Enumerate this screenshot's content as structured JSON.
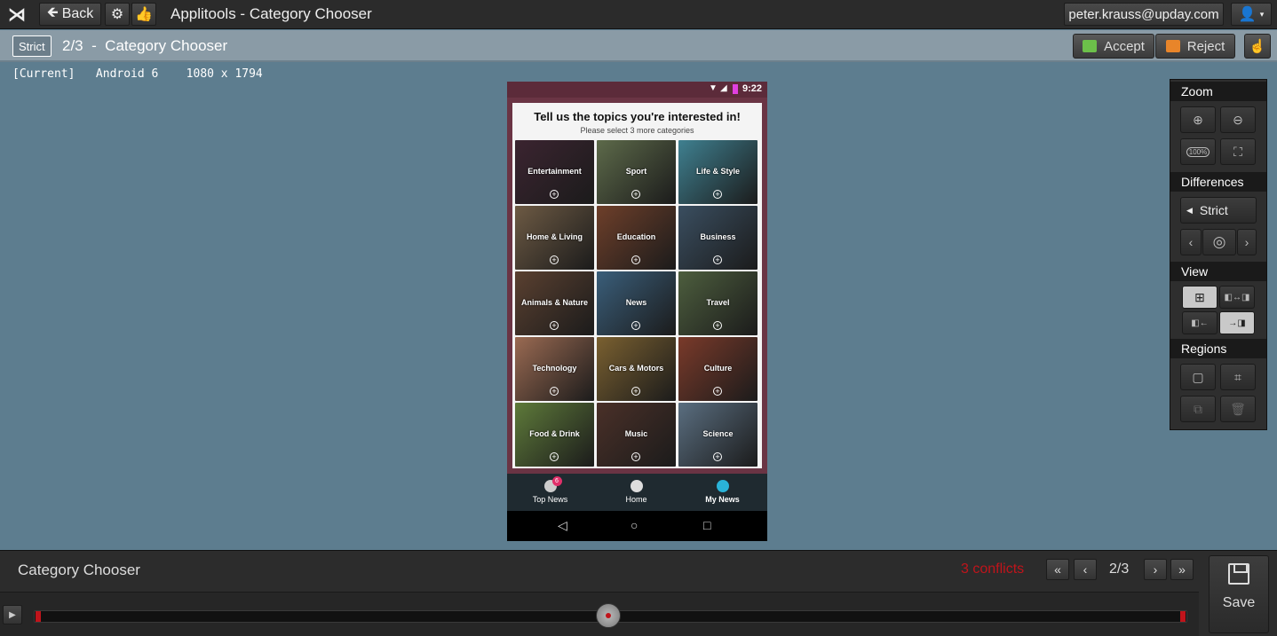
{
  "topbar": {
    "back_label": "Back",
    "title": "Applitools - Category Chooser",
    "user_email": "peter.krauss@upday.com"
  },
  "subbar": {
    "mode_badge": "Strict",
    "step_title": "2/3  -  Category Chooser",
    "accept_label": "Accept",
    "reject_label": "Reject"
  },
  "meta": {
    "line": "[Current]   Android 6    1080 x 1794"
  },
  "phone": {
    "time": "9:22",
    "card_title": "Tell us the topics you're interested in!",
    "card_subtitle": "Please select 3 more categories",
    "tiles": [
      {
        "label": "Entertainment",
        "color": "#3b2430"
      },
      {
        "label": "Sport",
        "color": "#5d6a4a"
      },
      {
        "label": "Life & Style",
        "color": "#3f8090"
      },
      {
        "label": "Home & Living",
        "color": "#6d5a44"
      },
      {
        "label": "Education",
        "color": "#6e3f2a"
      },
      {
        "label": "Business",
        "color": "#3a4e60"
      },
      {
        "label": "Animals & Nature",
        "color": "#5a4030"
      },
      {
        "label": "News",
        "color": "#3a5e7a"
      },
      {
        "label": "Travel",
        "color": "#4d5e3e"
      },
      {
        "label": "Technology",
        "color": "#9a6a52"
      },
      {
        "label": "Cars & Motors",
        "color": "#7a6030"
      },
      {
        "label": "Culture",
        "color": "#7a3a2a"
      },
      {
        "label": "Food & Drink",
        "color": "#5e7a3a"
      },
      {
        "label": "Music",
        "color": "#4a3028"
      },
      {
        "label": "Science",
        "color": "#5a6e80"
      }
    ],
    "nav": [
      {
        "label": "Top News",
        "badge": "6"
      },
      {
        "label": "Home"
      },
      {
        "label": "My News"
      }
    ]
  },
  "tool_panel": {
    "zoom_title": "Zoom",
    "differences_title": "Differences",
    "differences_level": "Strict",
    "view_title": "View",
    "regions_title": "Regions"
  },
  "bottombar": {
    "title": "Category Chooser",
    "conflicts": "3 conflicts",
    "step_counter": "2/3",
    "save_label": "Save"
  }
}
